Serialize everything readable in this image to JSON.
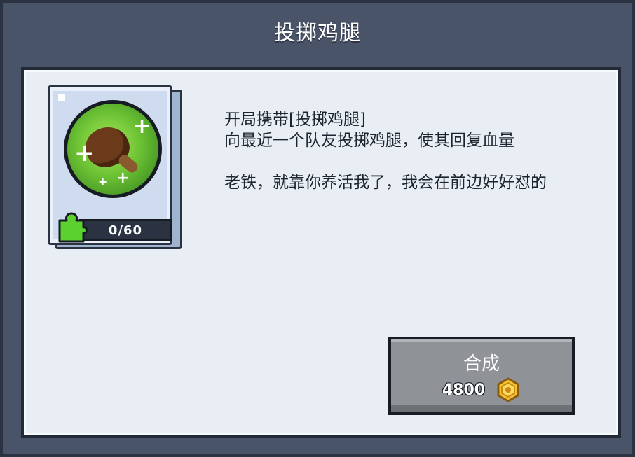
{
  "dialog": {
    "title": "投掷鸡腿"
  },
  "skill_card": {
    "icon": "drumstick-icon",
    "piece_icon": "puzzle-piece-icon",
    "progress_text": "0/60",
    "progress_fraction": 0
  },
  "description": {
    "line1": "开局携带[投掷鸡腿]",
    "line2": "向最近一个队友投掷鸡腿，使其回复血量",
    "flavor": "老铁，就靠你养活我了，我会在前边好好怼的"
  },
  "craft": {
    "label": "合成",
    "cost": "4800",
    "currency_icon": "gold-coin-icon"
  },
  "colors": {
    "frame": "#4a5468",
    "panel": "#e8eef3",
    "accent_green": "#5bd12f",
    "button": "#8f9397"
  }
}
